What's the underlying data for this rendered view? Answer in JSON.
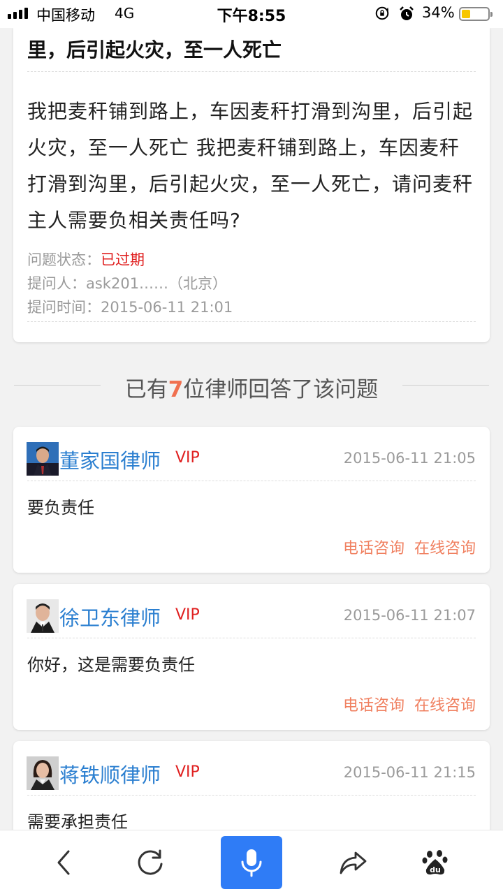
{
  "status_bar": {
    "carrier": "中国移动",
    "network": "4G",
    "time": "下午8:55",
    "battery": "34%",
    "battery_level": 0.34
  },
  "question": {
    "title_tail": "里，后引起火灾，至一人死亡",
    "body": "我把麦秆铺到路上，车因麦秆打滑到沟里，后引起火灾，至一人死亡 我把麦秆铺到路上，车因麦秆打滑到沟里，后引起火灾，至一人死亡，请问麦秆主人需要负相关责任吗?",
    "status_label": "问题状态：",
    "status_value": "已过期",
    "asker_label": "提问人：",
    "asker_value": "ask201……（北京）",
    "time_label": "提问时间：",
    "time_value": "2015-06-11 21:01"
  },
  "answers_header": {
    "prefix": "已有",
    "count": "7",
    "suffix": "位律师回答了该问题"
  },
  "answers": [
    {
      "lawyer": "董家国律师",
      "badge": "VIP",
      "time": "2015-06-11 21:05",
      "text": "要负责任",
      "phone_label": "电话咨询",
      "online_label": "在线咨询"
    },
    {
      "lawyer": "徐卫东律师",
      "badge": "VIP",
      "time": "2015-06-11 21:07",
      "text": "你好，这是需要负责任",
      "phone_label": "电话咨询",
      "online_label": "在线咨询"
    },
    {
      "lawyer": "蒋铁顺律师",
      "badge": "VIP",
      "time": "2015-06-11 21:15",
      "text": "需要承担责任",
      "phone_label": "",
      "online_label": ""
    }
  ],
  "toolbar": {
    "icons": [
      "back-icon",
      "refresh-icon",
      "microphone-icon",
      "share-icon",
      "baidu-paw-icon"
    ],
    "mic_color": "#2f7cf6"
  },
  "colors": {
    "accent_red": "#e02020",
    "link_blue": "#2b7fd0",
    "action_orange": "#f08060"
  }
}
